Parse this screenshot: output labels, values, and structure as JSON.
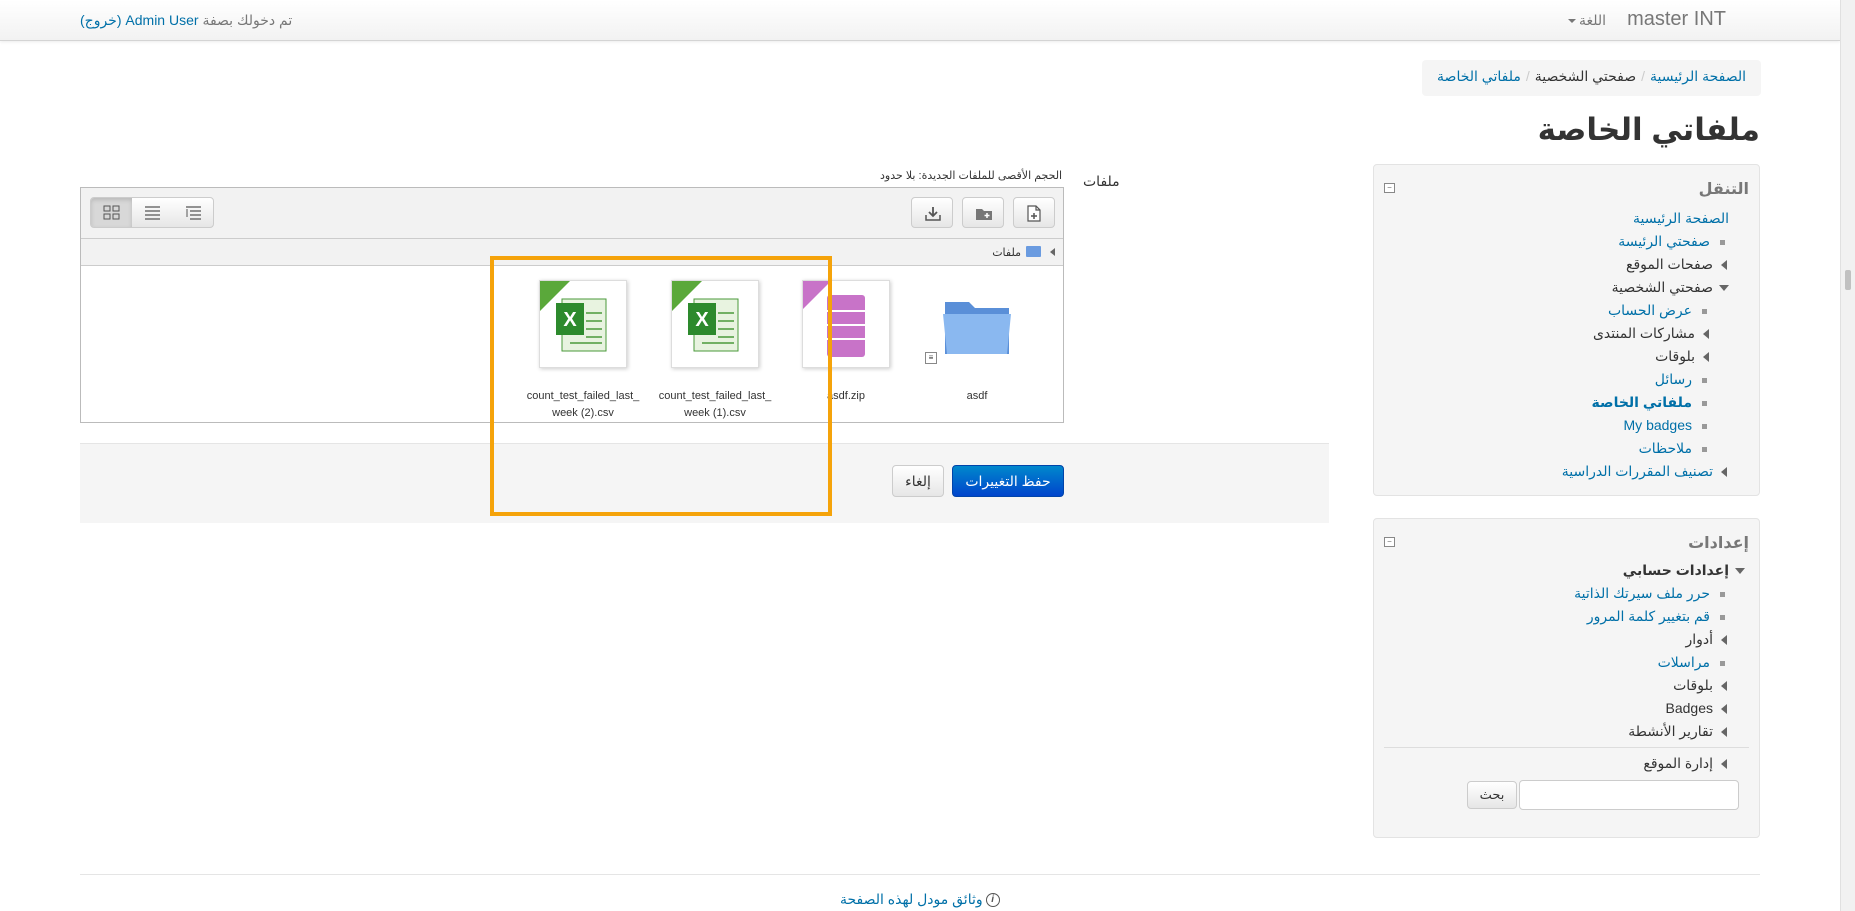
{
  "navbar": {
    "brand": "master INT",
    "language": "اللغة",
    "login_prefix": "تم دخولك بصفة",
    "user_name": "Admin User",
    "logout": "(خروج)"
  },
  "breadcrumb": {
    "home": "الصفحة الرئيسية",
    "profile": "صفحتي الشخصية",
    "current": "ملفاتي الخاصة"
  },
  "page_title": "ملفاتي الخاصة",
  "form": {
    "label": "ملفات",
    "max_size": "الحجم الأقصى للملفات الجديدة: بلا حدود",
    "path_label": "ملفات",
    "files": [
      {
        "name": "asdf",
        "type": "folder"
      },
      {
        "name": "asdf.zip",
        "type": "archive"
      },
      {
        "name": "count_test_failed_last_week (1).csv",
        "type": "spreadsheet"
      },
      {
        "name": "count_test_failed_last_week (2).csv",
        "type": "spreadsheet"
      }
    ],
    "save": "حفظ التغييرات",
    "cancel": "إلغاء"
  },
  "navigation_block": {
    "title": "التنقل",
    "items": [
      {
        "label": "الصفحة الرئيسية"
      },
      {
        "label": "صفحتي الرئيسة"
      },
      {
        "label": "صفحات الموقع"
      },
      {
        "label": "صفحتي الشخصية"
      },
      {
        "label": "عرض الحساب"
      },
      {
        "label": "مشاركات المنتدى"
      },
      {
        "label": "بلوقات"
      },
      {
        "label": "رسائل"
      },
      {
        "label": "ملفاتي الخاصة"
      },
      {
        "label": "My badges"
      },
      {
        "label": "ملاحظات"
      },
      {
        "label": "تصنيف المقررات الدراسية"
      }
    ]
  },
  "settings_block": {
    "title": "إعدادات",
    "items": [
      {
        "label": "إعدادات حسابي"
      },
      {
        "label": "حرر ملف سيرتك الذاتية"
      },
      {
        "label": "قم بتغيير كلمة المرور"
      },
      {
        "label": "أدوار"
      },
      {
        "label": "مراسلات"
      },
      {
        "label": "بلوقات"
      },
      {
        "label": "Badges"
      },
      {
        "label": "تقارير الأنشطة"
      },
      {
        "label": "إدارة الموقع"
      }
    ],
    "search_button": "بحث"
  },
  "footer": {
    "docs_link": "وثائق مودل لهذه الصفحة"
  },
  "colors": {
    "link": "#0070a8",
    "primary_button": "#0055cc",
    "highlight": "#f5a30a"
  }
}
